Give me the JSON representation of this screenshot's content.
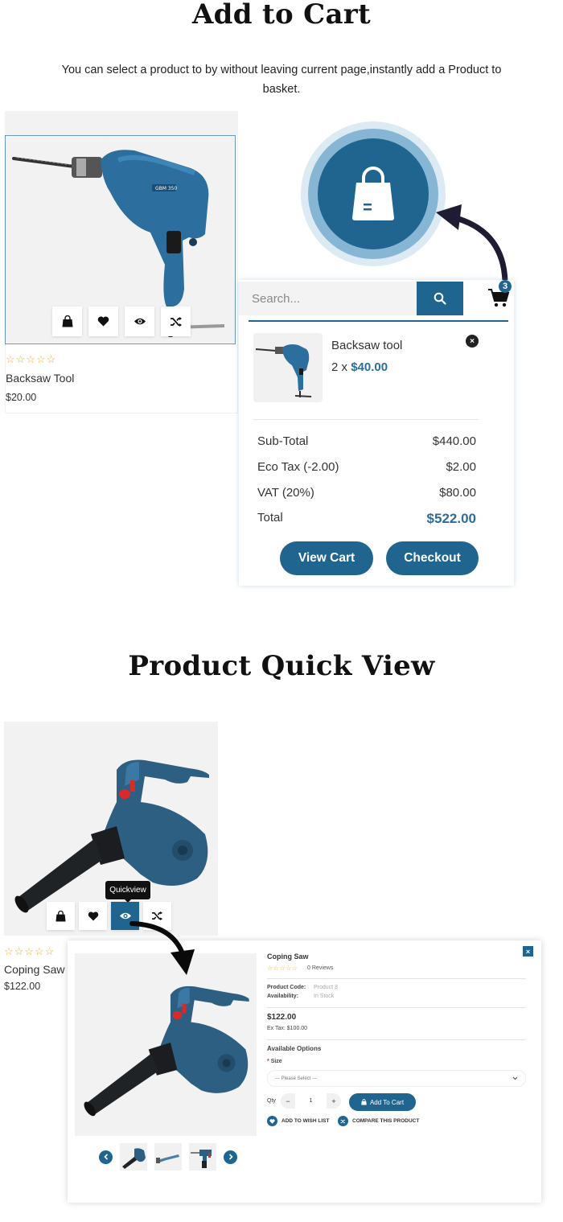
{
  "sections": {
    "add_to_cart": {
      "title": "Add to Cart",
      "description": "You can select a product to by without leaving current page,instantly add a Product to basket."
    },
    "quick_view": {
      "title": "Product Quick View"
    }
  },
  "product_card_1": {
    "name": "Backsaw Tool",
    "price": "$20.00",
    "rating_stars": "☆☆☆☆☆",
    "rating": 0,
    "actions": [
      "add-to-cart",
      "wishlist",
      "quickview",
      "compare"
    ]
  },
  "cart_dropdown": {
    "search_placeholder": "Search...",
    "cart_count": "3",
    "item": {
      "name": "Backsaw tool",
      "qty_prefix": "2 x ",
      "price": "$40.00",
      "remove_label": "×"
    },
    "totals": [
      {
        "label": "Sub-Total",
        "value": "$440.00"
      },
      {
        "label": "Eco Tax (-2.00)",
        "value": "$2.00"
      },
      {
        "label": "VAT (20%)",
        "value": "$80.00"
      },
      {
        "label": "Total",
        "value": "$522.00"
      }
    ],
    "view_cart_label": "View Cart",
    "checkout_label": "Checkout"
  },
  "product_card_2": {
    "name": "Coping Saw",
    "price": "$122.00",
    "rating_stars": "☆☆☆☆☆",
    "rating": 0,
    "tooltip": "Quickview"
  },
  "quick_view_modal": {
    "close_label": "×",
    "title": "Coping Saw",
    "rating_stars": "☆☆☆☆☆",
    "reviews": "0 Reviews",
    "product_code_label": "Product Code:",
    "product_code": "Product 8",
    "availability_label": "Availability:",
    "availability": "In Stock",
    "price": "$122.00",
    "ex_tax": "Ex Tax: $100.00",
    "options_heading": "Available Options",
    "size_required": "*",
    "size_label": "Size",
    "size_select_value": "--- Please Select ---",
    "qty_label": "Qty",
    "qty_minus": "−",
    "qty_value": "1",
    "qty_plus": "+",
    "add_to_cart_label": "Add To Cart",
    "wishlist_label": "ADD TO WISH LIST",
    "compare_label": "COMPARE THIS PRODUCT",
    "thumbnails": [
      "blower",
      "grinder",
      "drill"
    ]
  },
  "colors": {
    "brand_blue": "#1f6590",
    "price_blue": "#2b6e9b",
    "star_yellow": "#f2b01e"
  }
}
